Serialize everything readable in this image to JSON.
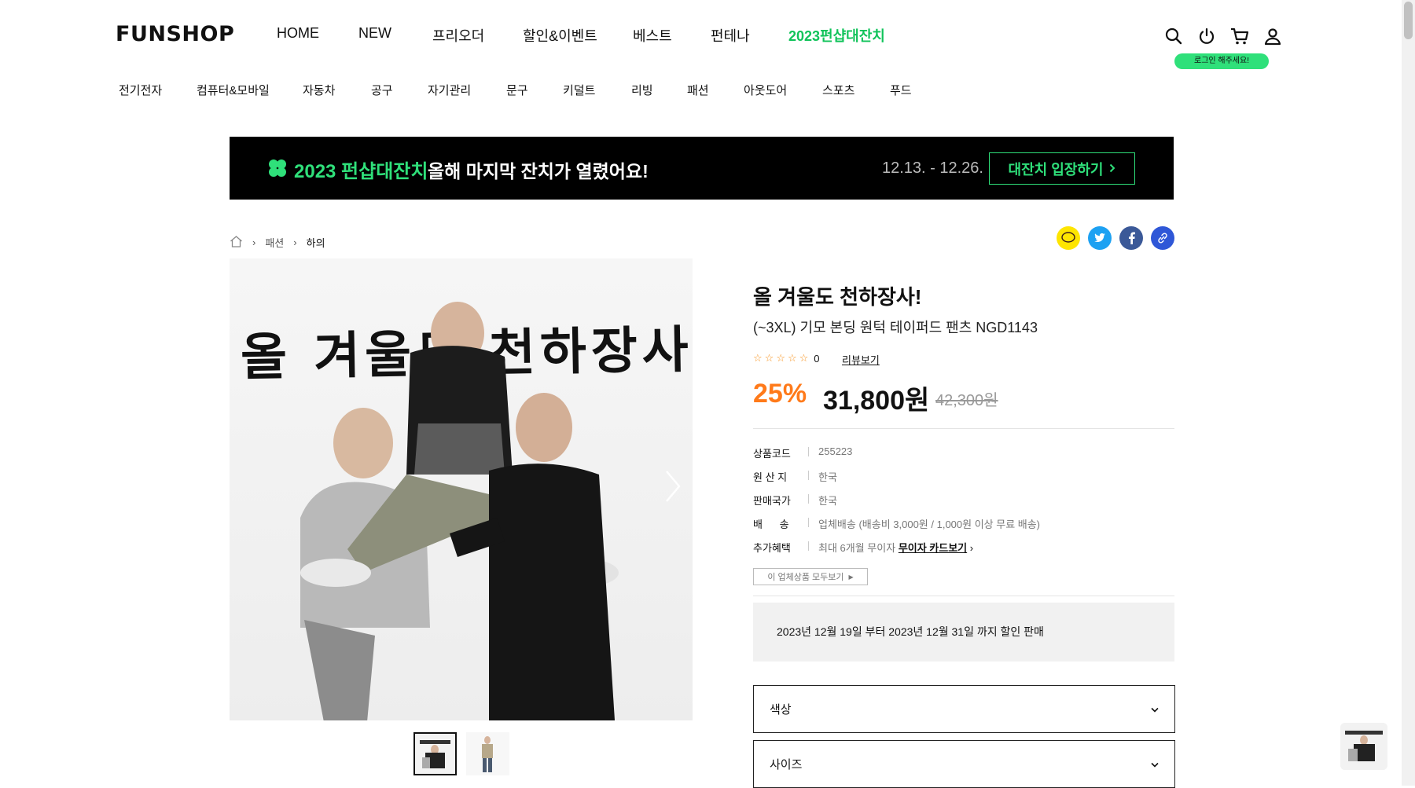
{
  "header": {
    "logo": "FUNSHOP",
    "nav": [
      {
        "label": "HOME"
      },
      {
        "label": "NEW"
      },
      {
        "label": "프리오더"
      },
      {
        "label": "할인&이벤트"
      },
      {
        "label": "베스트"
      },
      {
        "label": "펀테나"
      },
      {
        "label": "2023펀샵대잔치"
      }
    ],
    "login_tip": "로그인 해주세요!",
    "categories": [
      "전기전자",
      "컴퓨터&모바일",
      "자동차",
      "공구",
      "자기관리",
      "문구",
      "키덜트",
      "리빙",
      "패션",
      "아웃도어",
      "스포츠",
      "푸드"
    ]
  },
  "banner": {
    "title": "2023 펀샵대잔치",
    "subtitle": "올해 마지막 잔치가 열렸어요!",
    "dates": "12.13. - 12.26.",
    "button": "대잔치 입장하기",
    "accent": "#2fe07a"
  },
  "breadcrumb": {
    "items": [
      "패션",
      "하의"
    ]
  },
  "gallery": {
    "main_caption": "올 겨울도 천하장사"
  },
  "product": {
    "title": "올 겨울도 천하장사!",
    "subtitle": "(~3XL) 기모 본딩 원턱 테이퍼드 팬츠 NGD1143",
    "rating": 0,
    "review_count": "0",
    "review_link": "리뷰보기",
    "discount": "25%",
    "price": "31,800원",
    "original_price": "42,300원",
    "specs": [
      {
        "label": "상품코드",
        "value": "255223"
      },
      {
        "label": "원 산 지",
        "value": "한국"
      },
      {
        "label": "판매국가",
        "value": "한국"
      },
      {
        "label": "배      송",
        "value": "업체배송 (배송비 3,000원 / 1,000원 이상 무료 배송)"
      },
      {
        "label": "추가혜택",
        "value": "최대 6개월 무이자",
        "link": "무이자 카드보기"
      }
    ],
    "all_products_button": "이 업체상품 모두보기",
    "notice": "2023년 12월 19일 부터 2023년 12월 31일 까지 할인 판매",
    "options": [
      {
        "label": "색상"
      },
      {
        "label": "사이즈"
      }
    ]
  }
}
